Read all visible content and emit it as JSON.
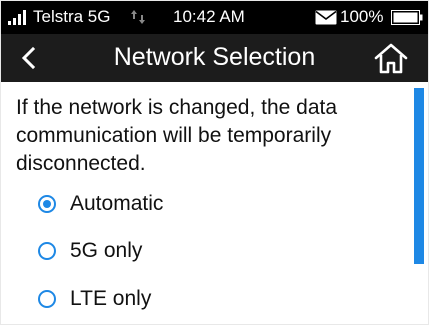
{
  "status_bar": {
    "carrier": "Telstra 5G",
    "time": "10:42 AM",
    "battery_percent": "100%",
    "signal_icon": "signal-bars-icon",
    "data_icon": "data-transfer-icon",
    "mail_icon": "mail-icon",
    "battery_icon": "battery-full-icon"
  },
  "header": {
    "title": "Network Selection",
    "back_icon": "chevron-left-icon",
    "home_icon": "home-icon"
  },
  "main": {
    "info_text": "If the network is changed, the data communication will be temporarily disconnected.",
    "options": [
      {
        "label": "Automatic",
        "selected": true
      },
      {
        "label": "5G only",
        "selected": false
      },
      {
        "label": "LTE only",
        "selected": false
      }
    ]
  },
  "colors": {
    "accent": "#1e88e5",
    "header_bg": "#1c1c1c",
    "status_bg": "#000000",
    "content_bg": "#ffffff"
  }
}
